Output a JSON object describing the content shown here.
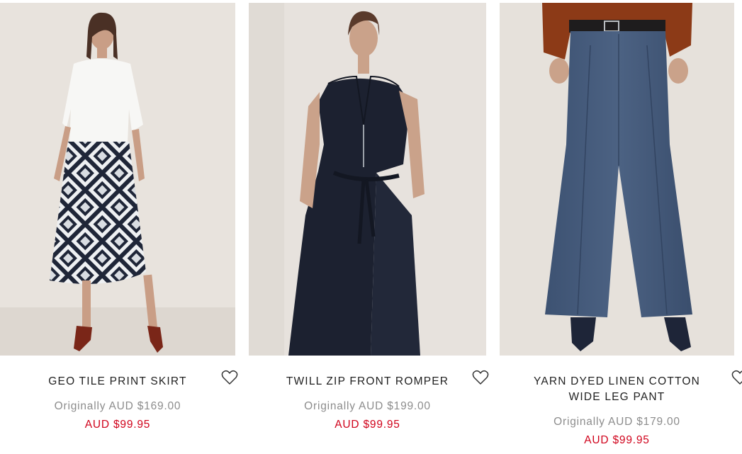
{
  "products": [
    {
      "name": "GEO TILE PRINT SKIRT",
      "original_price": "Originally AUD $169.00",
      "sale_price": "AUD $99.95",
      "wishlist_icon": "heart-outline-icon"
    },
    {
      "name": "TWILL ZIP FRONT ROMPER",
      "original_price": "Originally AUD $199.00",
      "sale_price": "AUD $99.95",
      "wishlist_icon": "heart-outline-icon"
    },
    {
      "name": "YARN DYED LINEN COTTON WIDE LEG PANT",
      "original_price": "Originally AUD $179.00",
      "sale_price": "AUD $99.95",
      "wishlist_icon": "heart-outline-icon"
    }
  ],
  "colors": {
    "sale_price": "#d0021b",
    "original_price": "#8c8c8c",
    "image_background": "#e6e0da"
  }
}
